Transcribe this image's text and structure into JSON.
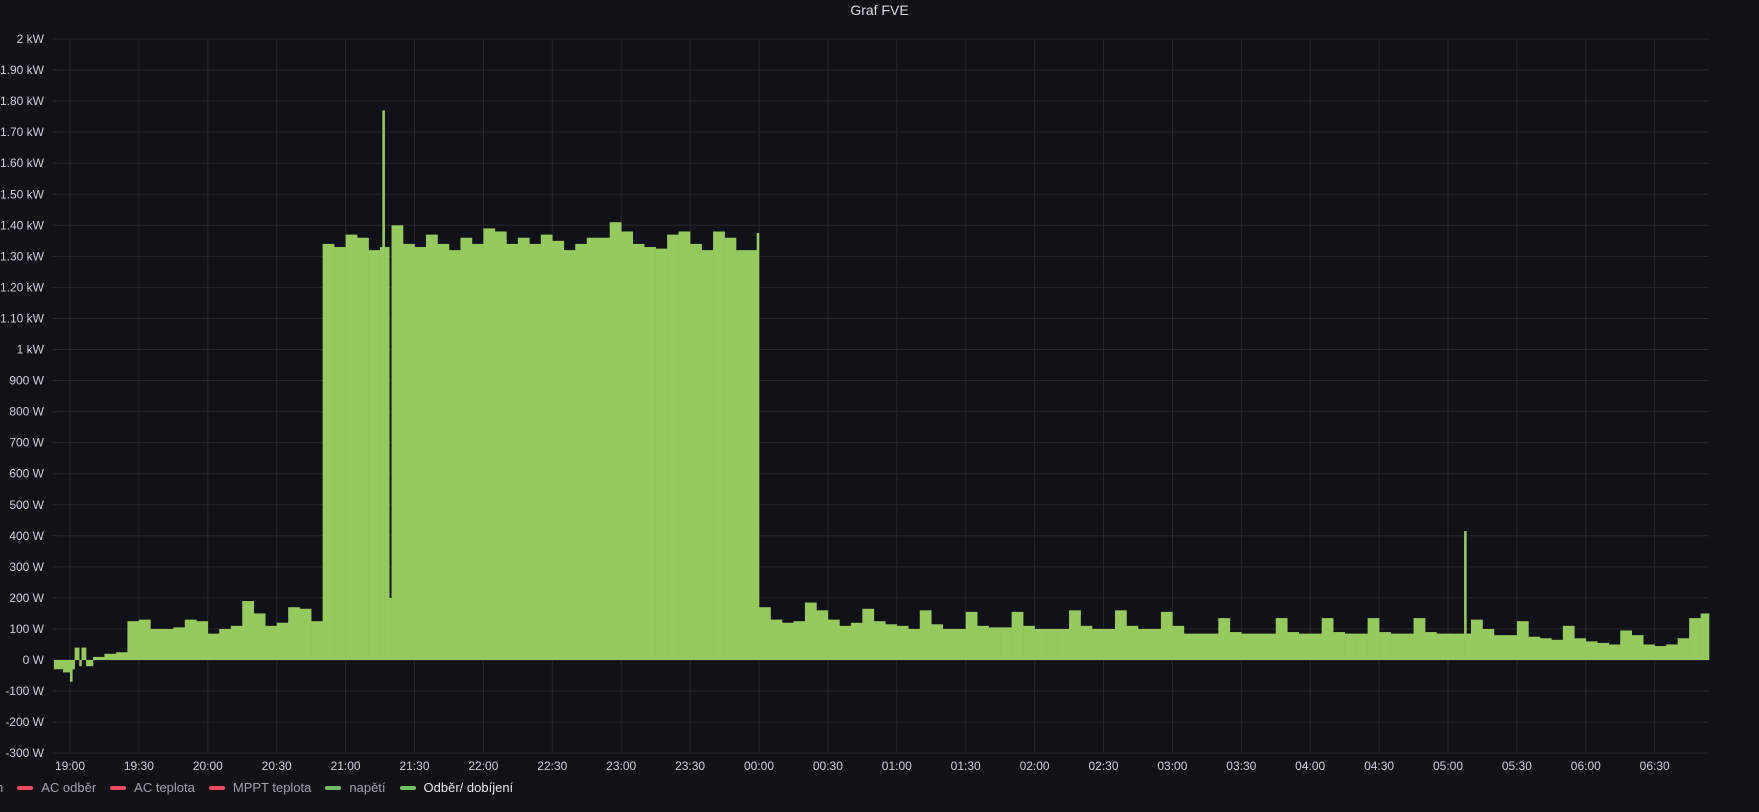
{
  "panel": {
    "title": "Graf FVE"
  },
  "legend": [
    {
      "label": "n",
      "color": "#73BF69",
      "partial": true
    },
    {
      "label": "AC odběr",
      "color": "#F2495C"
    },
    {
      "label": "AC teplota",
      "color": "#F2495C"
    },
    {
      "label": "MPPT teplota",
      "color": "#F2495C"
    },
    {
      "label": "napětí",
      "color": "#73BF69"
    },
    {
      "label": "Odběr/ dobíjení",
      "color": "#73BF69",
      "active": true
    }
  ],
  "chart_data": {
    "type": "area",
    "title": "Graf FVE",
    "xlabel": "",
    "ylabel": "",
    "ylim": [
      -300,
      2000
    ],
    "grid": true,
    "legend_position": "bottom-left",
    "yticks": [
      "2 kW",
      "1.90 kW",
      "1.80 kW",
      "1.70 kW",
      "1.60 kW",
      "1.50 kW",
      "1.40 kW",
      "1.30 kW",
      "1.20 kW",
      "1.10 kW",
      "1 kW",
      "900 W",
      "800 W",
      "700 W",
      "600 W",
      "500 W",
      "400 W",
      "300 W",
      "200 W",
      "100 W",
      "0 W",
      "-100 W",
      "-200 W",
      "-300 W"
    ],
    "xticks": [
      "19:00",
      "19:30",
      "20:00",
      "20:30",
      "21:00",
      "21:30",
      "22:00",
      "22:30",
      "23:00",
      "23:30",
      "00:00",
      "00:30",
      "01:00",
      "01:30",
      "02:00",
      "02:30",
      "03:00",
      "03:30",
      "04:00",
      "04:30",
      "05:00",
      "05:30",
      "06:00",
      "06:30"
    ],
    "series": [
      {
        "name": "Odběr/ dobíjení",
        "color": "#96C95E",
        "unit": "W",
        "x": [
          "18:53",
          "18:57",
          "19:00",
          "19:01",
          "19:02",
          "19:04",
          "19:05",
          "19:07",
          "19:10",
          "19:15",
          "19:20",
          "19:25",
          "19:30",
          "19:35",
          "19:40",
          "19:45",
          "19:50",
          "19:55",
          "20:00",
          "20:05",
          "20:10",
          "20:15",
          "20:20",
          "20:25",
          "20:30",
          "20:35",
          "20:40",
          "20:45",
          "20:50",
          "20:55",
          "21:00",
          "21:05",
          "21:10",
          "21:15",
          "21:16",
          "21:17",
          "21:19",
          "21:20",
          "21:25",
          "21:30",
          "21:35",
          "21:40",
          "21:45",
          "21:50",
          "21:55",
          "22:00",
          "22:05",
          "22:10",
          "22:15",
          "22:20",
          "22:25",
          "22:30",
          "22:35",
          "22:40",
          "22:45",
          "22:50",
          "22:55",
          "23:00",
          "23:05",
          "23:10",
          "23:15",
          "23:20",
          "23:25",
          "23:30",
          "23:35",
          "23:40",
          "23:45",
          "23:50",
          "23:55",
          "23:59",
          "00:00",
          "00:05",
          "00:10",
          "00:15",
          "00:20",
          "00:25",
          "00:30",
          "00:35",
          "00:40",
          "00:45",
          "00:50",
          "00:55",
          "01:00",
          "01:05",
          "01:10",
          "01:15",
          "01:20",
          "01:25",
          "01:30",
          "01:35",
          "01:40",
          "01:45",
          "01:50",
          "01:55",
          "02:00",
          "02:05",
          "02:10",
          "02:15",
          "02:20",
          "02:25",
          "02:30",
          "02:35",
          "02:40",
          "02:45",
          "02:50",
          "02:55",
          "03:00",
          "03:05",
          "03:10",
          "03:15",
          "03:20",
          "03:25",
          "03:30",
          "03:35",
          "03:40",
          "03:45",
          "03:50",
          "03:55",
          "04:00",
          "04:05",
          "04:10",
          "04:15",
          "04:20",
          "04:25",
          "04:30",
          "04:35",
          "04:40",
          "04:45",
          "04:50",
          "04:55",
          "05:00",
          "05:05",
          "05:07",
          "05:08",
          "05:10",
          "05:15",
          "05:20",
          "05:25",
          "05:30",
          "05:35",
          "05:40",
          "05:45",
          "05:50",
          "05:55",
          "06:00",
          "06:05",
          "06:10",
          "06:15",
          "06:20",
          "06:25",
          "06:30",
          "06:35",
          "06:40",
          "06:45",
          "06:50"
        ],
        "values": [
          -30,
          -40,
          -70,
          -30,
          40,
          -20,
          40,
          -20,
          10,
          20,
          25,
          125,
          130,
          100,
          100,
          105,
          130,
          125,
          85,
          100,
          110,
          190,
          150,
          110,
          120,
          170,
          165,
          125,
          1340,
          1330,
          1370,
          1360,
          1320,
          1330,
          1770,
          1330,
          200,
          1400,
          1340,
          1330,
          1370,
          1340,
          1320,
          1360,
          1340,
          1390,
          1380,
          1340,
          1360,
          1340,
          1370,
          1350,
          1320,
          1340,
          1360,
          1360,
          1410,
          1380,
          1340,
          1330,
          1325,
          1370,
          1380,
          1340,
          1320,
          1380,
          1360,
          1320,
          1320,
          1375,
          170,
          130,
          120,
          125,
          185,
          160,
          130,
          110,
          120,
          165,
          125,
          115,
          110,
          100,
          160,
          115,
          100,
          100,
          155,
          110,
          105,
          105,
          155,
          110,
          100,
          100,
          100,
          160,
          110,
          100,
          100,
          160,
          110,
          100,
          100,
          155,
          110,
          85,
          85,
          85,
          135,
          90,
          85,
          85,
          85,
          135,
          90,
          85,
          85,
          135,
          90,
          85,
          85,
          135,
          90,
          85,
          85,
          135,
          90,
          85,
          85,
          85,
          415,
          85,
          130,
          100,
          80,
          80,
          125,
          75,
          70,
          65,
          110,
          70,
          60,
          55,
          50,
          95,
          80,
          50,
          45,
          50,
          70,
          135,
          150
        ]
      }
    ]
  }
}
